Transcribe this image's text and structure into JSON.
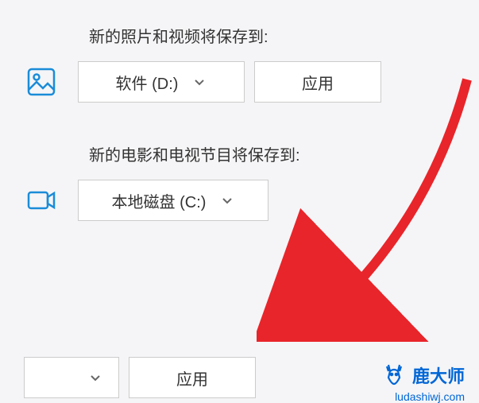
{
  "sections": {
    "photos": {
      "label": "新的照片和视频将保存到:",
      "dropdown_value": "软件 (D:)",
      "apply_label": "应用"
    },
    "movies": {
      "label": "新的电影和电视节目将保存到:",
      "dropdown_value": "本地磁盘 (C:)"
    }
  },
  "bottom": {
    "apply_label": "应用"
  },
  "watermark": {
    "brand": "鹿大师",
    "url": "ludashiwj.com"
  },
  "colors": {
    "icon": "#1a8cd8",
    "arrow": "#e8252a",
    "brand": "#0066d6"
  }
}
